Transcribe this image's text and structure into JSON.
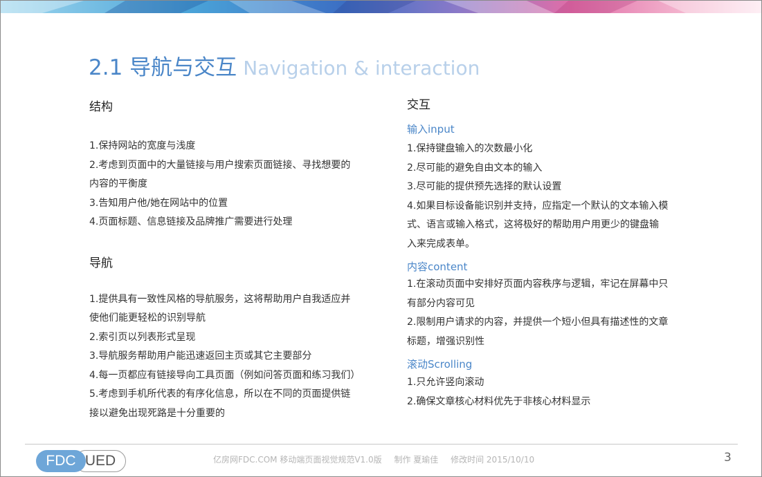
{
  "slide": {
    "title_cn": "2.1 导航与交互",
    "title_en": "Navigation & interaction",
    "left": {
      "structure_heading": "结构",
      "structure_items": [
        "1.保持网站的宽度与浅度",
        "2.考虑到页面中的大量链接与用户搜索页面链接、寻找想要的",
        "内容的平衡度",
        "3.告知用户他/她在网站中的位置",
        "4.页面标题、信息链接及品牌推广需要进行处理"
      ],
      "nav_heading": "导航",
      "nav_items": [
        "1.提供具有一致性风格的导航服务，这将帮助用户自我适应并",
        "使他们能更轻松的识别导航",
        "2.索引页以列表形式呈现",
        "3.导航服务帮助用户能迅速返回主页或其它主要部分",
        "4.每一页都应有链接导向工具页面（例如问答页面和练习我们）",
        "5.考虑到手机所代表的有序化信息，所以在不同的页面提供链",
        "接以避免出现死路是十分重要的"
      ]
    },
    "right": {
      "heading": "交互",
      "input_heading": "输入input",
      "input_items": [
        "1.保持键盘输入的次数最小化",
        "2.尽可能的避免自由文本的输入",
        "3.尽可能的提供预先选择的默认设置",
        "4.如果目标设备能识别并支持，应指定一个默认的文本输入模",
        "式、语言或输入格式，这将极好的帮助用户用更少的键盘输",
        "入来完成表单。"
      ],
      "content_heading": "内容content",
      "content_items": [
        "1.在滚动页面中安排好页面内容秩序与逻辑，牢记在屏幕中只",
        "有部分内容可见",
        "2.限制用户请求的内容，并提供一个短小但具有描述性的文章",
        "标题，增强识别性"
      ],
      "scroll_heading": "滚动Scrolling",
      "scroll_items": [
        "1.只允许竖向滚动",
        "2.确保文章核心材料优先于非核心材料显示"
      ]
    }
  },
  "footer": {
    "logo_left": "FDC",
    "logo_right": "UED",
    "site": "亿房网FDC.COM 移动端页面视觉规范V1.0版",
    "author": "制作 夏瑜佳",
    "modified": "修改时间  2015/10/10",
    "page_number": "3"
  },
  "colors": {
    "accent_blue": "#4a86c8",
    "title_en_blue": "#b8d0ea",
    "banner": [
      "#7fc8e8",
      "#5b8fd6",
      "#e58ab6",
      "#f2c1d4"
    ]
  }
}
